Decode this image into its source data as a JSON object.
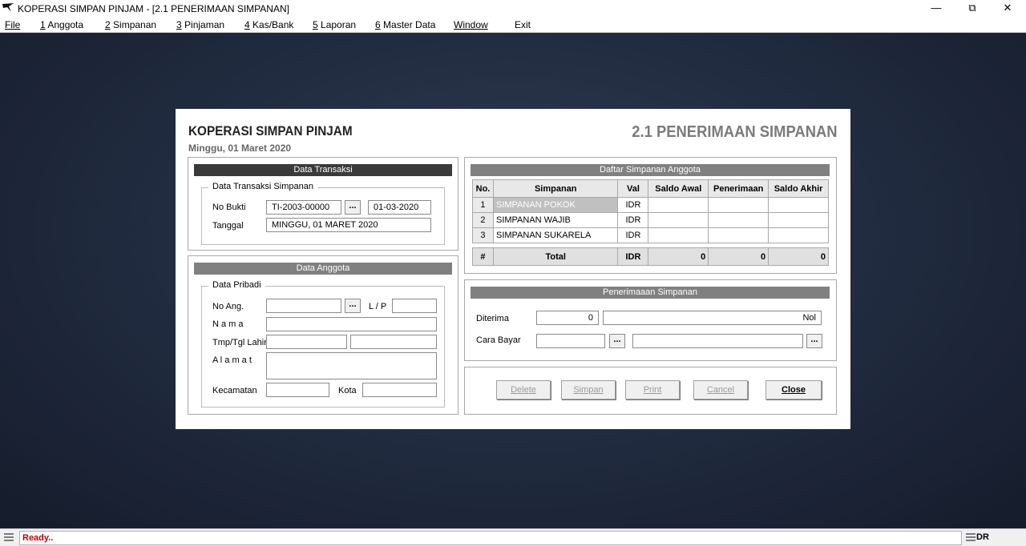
{
  "window": {
    "title": "KOPERASI SIMPAN PINJAM - [2.1 PENERIMAAN SIMPANAN]",
    "minimize": "—",
    "restore": "⧉",
    "close": "✕"
  },
  "menu": [
    {
      "key": "",
      "rest": "File"
    },
    {
      "key": "1",
      "rest": " Anggota"
    },
    {
      "key": "2",
      "rest": " Simpanan"
    },
    {
      "key": "3",
      "rest": " Pinjaman"
    },
    {
      "key": "4",
      "rest": " Kas/Bank"
    },
    {
      "key": "5",
      "rest": " Laporan"
    },
    {
      "key": "6",
      "rest": " Master Data"
    },
    {
      "key": "",
      "rest": "Window"
    },
    {
      "key": "",
      "rest": "Exit"
    }
  ],
  "form": {
    "app_title": "KOPERASI SIMPAN PINJAM",
    "date": "Minggu, 01 Maret 2020",
    "heading": "2.1 PENERIMAAN SIMPANAN"
  },
  "transaksi": {
    "header": "Data Transaksi",
    "group": "Data Transaksi Simpanan",
    "no_bukti_label": "No Bukti",
    "no_bukti": "TI-2003-00000",
    "no_bukti_date": "01-03-2020",
    "tanggal_label": "Tanggal",
    "tanggal": "MINGGU, 01 MARET 2020",
    "lookup": "..."
  },
  "anggota": {
    "header": "Data Anggota",
    "group": "Data Pribadi",
    "no_ang_label": "No Ang.",
    "lp_label": "L / P",
    "nama_label": "N a m a",
    "ttl_label": "Tmp/Tgl Lahir",
    "alamat_label": "A l a m a t",
    "kecamatan_label": "Kecamatan",
    "kota_label": "Kota",
    "lookup": "..."
  },
  "daftar": {
    "header": "Daftar Simpanan Anggota",
    "columns": [
      "No.",
      "Simpanan",
      "Val",
      "Saldo Awal",
      "Penerimaan",
      "Saldo Akhir"
    ],
    "rows": [
      {
        "no": "1",
        "simpanan": "SIMPANAN POKOK",
        "val": "IDR",
        "awal": "",
        "terima": "",
        "akhir": ""
      },
      {
        "no": "2",
        "simpanan": "SIMPANAN WAJIB",
        "val": "IDR",
        "awal": "",
        "terima": "",
        "akhir": ""
      },
      {
        "no": "3",
        "simpanan": "SIMPANAN SUKARELA",
        "val": "IDR",
        "awal": "",
        "terima": "",
        "akhir": ""
      }
    ],
    "total": {
      "no": "#",
      "label": "Total",
      "val": "IDR",
      "awal": "0",
      "terima": "0",
      "akhir": "0"
    }
  },
  "penerimaan": {
    "header": "Penerimaaan Simpanan",
    "diterima_label": "Diterima",
    "diterima": "0",
    "terbilang": "Nol",
    "cara_bayar_label": "Cara Bayar",
    "lookup": "..."
  },
  "buttons": {
    "delete": "Delete",
    "simpan": "Simpan",
    "print": "Print",
    "cancel": "Cancel",
    "close": "Close"
  },
  "status": {
    "text": "Ready..",
    "right": "DR"
  }
}
